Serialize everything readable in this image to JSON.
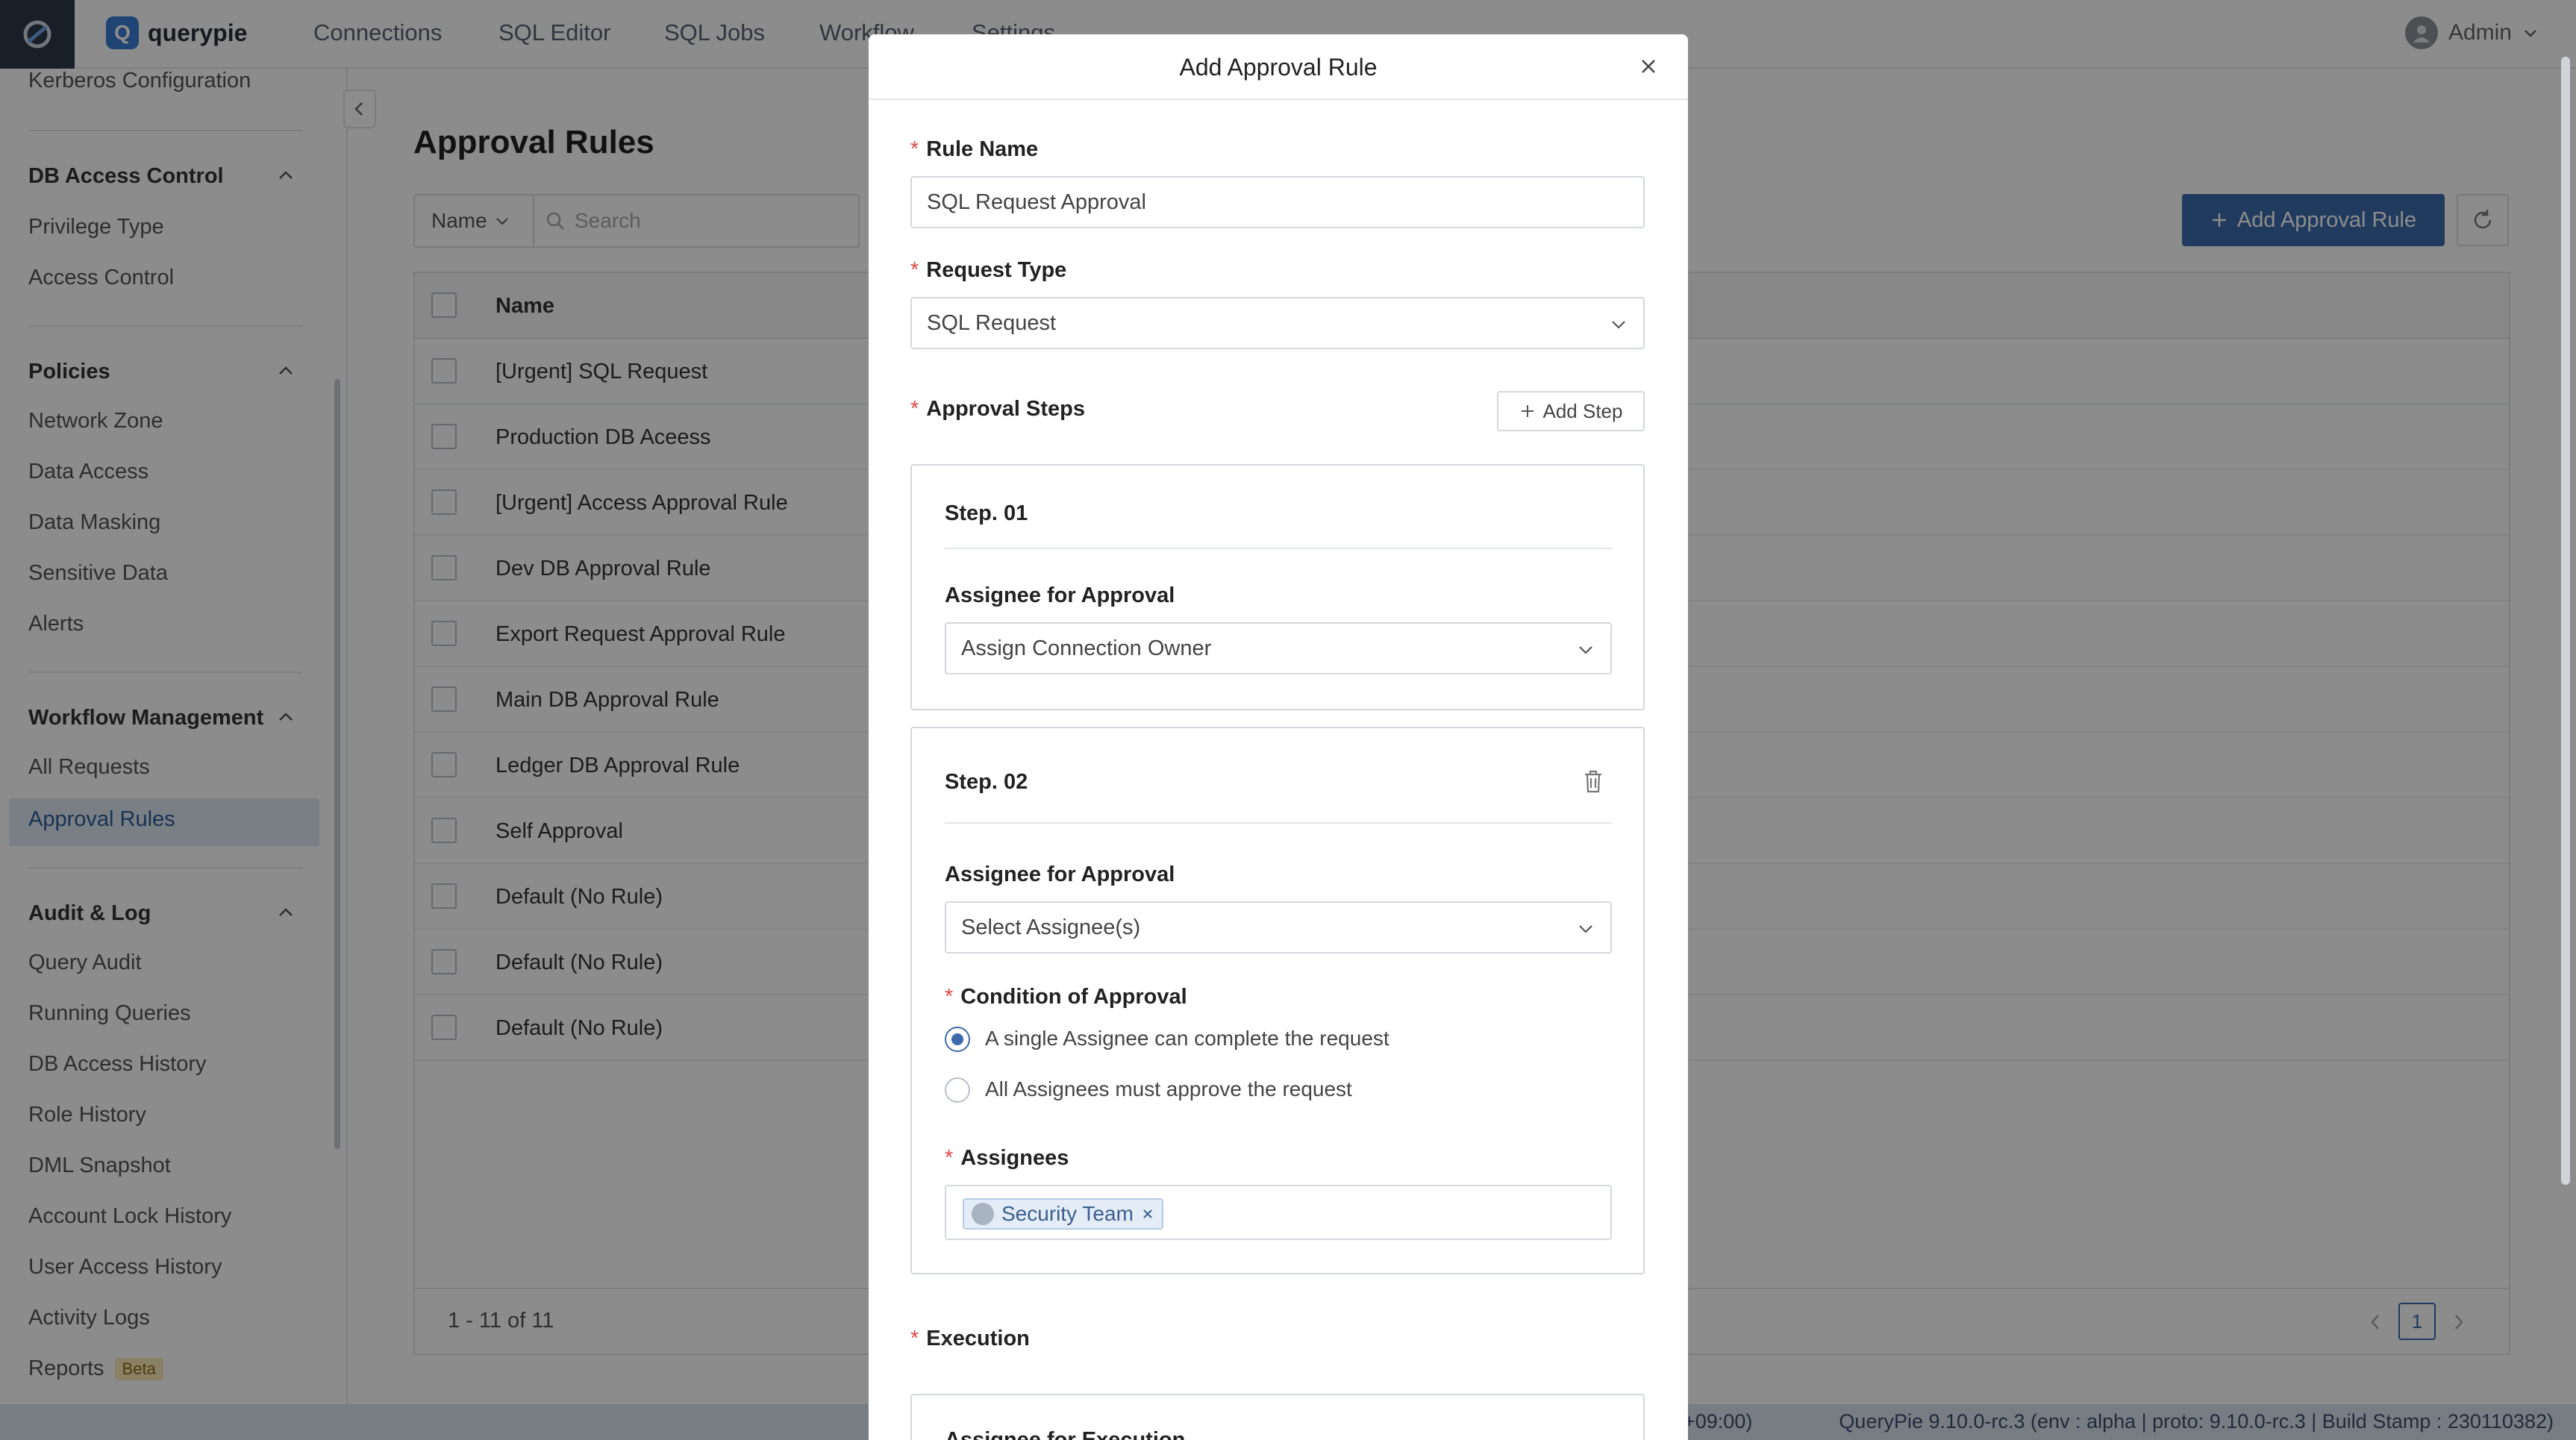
{
  "app": {
    "brand": "querypie"
  },
  "nav": [
    "Connections",
    "SQL Editor",
    "SQL Jobs",
    "Workflow",
    "Settings"
  ],
  "user": {
    "name": "Admin"
  },
  "sidebar": {
    "top_item": "Kerberos Configuration",
    "sections": [
      {
        "title": "DB Access Control",
        "items": [
          "Privilege Type",
          "Access Control"
        ]
      },
      {
        "title": "Policies",
        "items": [
          "Network Zone",
          "Data Access",
          "Data Masking",
          "Sensitive Data",
          "Alerts"
        ]
      },
      {
        "title": "Workflow Management",
        "items": [
          "All Requests",
          "Approval Rules"
        ]
      },
      {
        "title": "Audit & Log",
        "items": [
          "Query Audit",
          "Running Queries",
          "DB Access History",
          "Role History",
          "DML Snapshot",
          "Account Lock History",
          "User Access History",
          "Activity Logs",
          "Reports"
        ]
      }
    ],
    "active": "Approval Rules",
    "beta_badge": "Beta"
  },
  "main": {
    "title": "Approval Rules",
    "filter_select": "Name",
    "search_placeholder": "Search",
    "add_button": "Add Approval Rule",
    "table": {
      "column_name": "Name",
      "rows": [
        "[Urgent] SQL Request",
        "Production DB Aceess",
        "[Urgent] Access Approval Rule",
        "Dev DB Approval Rule",
        "Export Request Approval Rule",
        "Main DB Approval Rule",
        "Ledger DB Approval Rule",
        "Self Approval",
        "Default (No Rule)",
        "Default (No Rule)",
        "Default (No Rule)"
      ]
    },
    "pagination": {
      "summary": "1 - 11 of 11",
      "page": "1"
    }
  },
  "status": {
    "tz_fragment": "+09:00)",
    "build": "QueryPie 9.10.0-rc.3 (env : alpha | proto: 9.10.0-rc.3 | Build Stamp : 230110382)"
  },
  "modal": {
    "title": "Add Approval Rule",
    "rule_name_label": "Rule Name",
    "rule_name_value": "SQL Request Approval",
    "request_type_label": "Request Type",
    "request_type_value": "SQL Request",
    "approval_steps_label": "Approval Steps",
    "add_step": "Add Step",
    "step1": {
      "title": "Step. 01",
      "assignee_label": "Assignee for Approval",
      "assignee_value": "Assign Connection Owner"
    },
    "step2": {
      "title": "Step. 02",
      "assignee_label": "Assignee for Approval",
      "assignee_placeholder": "Select Assignee(s)",
      "condition_label": "Condition of Approval",
      "option_single": "A single Assignee can complete the request",
      "option_all": "All Assignees must approve the request",
      "selected_option": "single",
      "assignees_label": "Assignees",
      "assignee_tag": "Security Team"
    },
    "execution_label": "Execution",
    "execution_sub": "Assignee for Execution"
  }
}
